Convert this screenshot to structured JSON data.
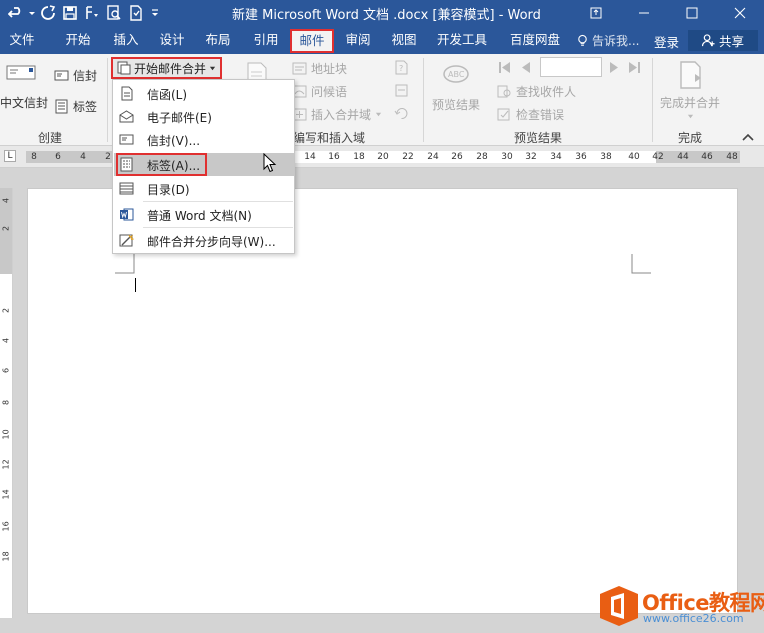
{
  "window": {
    "title": "新建 Microsoft Word 文档 .docx [兼容模式] - Word"
  },
  "tabs": [
    {
      "label": "文件"
    },
    {
      "label": "开始"
    },
    {
      "label": "插入"
    },
    {
      "label": "设计"
    },
    {
      "label": "布局"
    },
    {
      "label": "引用"
    },
    {
      "label": "邮件",
      "active": true
    },
    {
      "label": "审阅"
    },
    {
      "label": "视图"
    },
    {
      "label": "开发工具"
    },
    {
      "label": "百度网盘"
    }
  ],
  "header": {
    "tell_me": "告诉我...",
    "login": "登录",
    "share": "共享"
  },
  "ribbon": {
    "create": {
      "envelopes": "信封",
      "chinese_envelopes": "中文信封",
      "labels": "标签",
      "group_label": "创建"
    },
    "start_mail_merge": "开始邮件合并",
    "write_insert": {
      "address_block": "地址块",
      "greeting_line": "问候语",
      "insert_merge_field": "插入合并域",
      "group_label": "编写和插入域"
    },
    "preview": {
      "preview_results": "预览结果",
      "find_recipient": "查找收件人",
      "check_errors": "检查错误",
      "group_label": "预览结果"
    },
    "finish": {
      "finish_merge": "完成并合并",
      "group_label": "完成"
    }
  },
  "menu": {
    "items": [
      {
        "label": "信函(L)"
      },
      {
        "label": "电子邮件(E)"
      },
      {
        "label": "信封(V)..."
      },
      {
        "label": "标签(A)...",
        "hover": true
      },
      {
        "label": "目录(D)"
      },
      {
        "label": "普通 Word 文档(N)"
      },
      {
        "label": "邮件合并分步向导(W)..."
      }
    ]
  },
  "ruler": {
    "corner": "L",
    "left_ticks": [
      "8",
      "6",
      "4",
      "2"
    ],
    "right_ticks": [
      "14",
      "16",
      "18",
      "20",
      "22",
      "24",
      "26",
      "28",
      "30",
      "32",
      "34",
      "36",
      "38",
      "40",
      "42",
      "44",
      "46",
      "48"
    ],
    "vertical_ticks": [
      "4",
      "2",
      "2",
      "4",
      "6",
      "8",
      "10",
      "12",
      "14",
      "16",
      "18"
    ]
  },
  "watermark": {
    "name": "Office教程网",
    "url": "www.office26.com"
  },
  "colors": {
    "accent": "#2b579a",
    "highlight_border": "#e03030",
    "logo_orange": "#e95e13"
  }
}
